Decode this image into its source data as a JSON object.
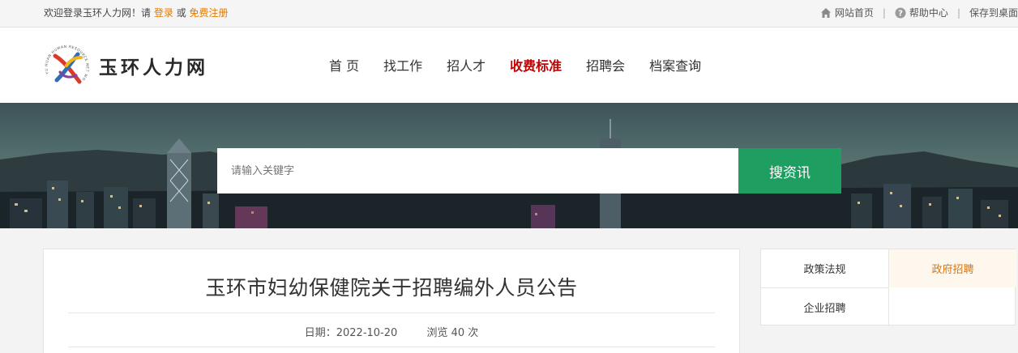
{
  "topbar": {
    "welcome_prefix": "欢迎登录玉环人力网！请",
    "login": "登录",
    "or": "或",
    "register": "免费注册",
    "links": [
      {
        "label": "网站首页",
        "icon": "home-icon"
      },
      {
        "label": "帮助中心",
        "icon": "help-icon"
      },
      {
        "label": "保存到桌面",
        "icon": ""
      }
    ],
    "separator": "|"
  },
  "header": {
    "logo_text": "玉环人力网",
    "logo_ring_text": "YU HUAN HUMAN RESOURCE NET WORK",
    "nav": [
      {
        "label": "首 页",
        "active": false
      },
      {
        "label": "找工作",
        "active": false
      },
      {
        "label": "招人才",
        "active": false
      },
      {
        "label": "收费标准",
        "active": true
      },
      {
        "label": "招聘会",
        "active": false
      },
      {
        "label": "档案查询",
        "active": false
      }
    ]
  },
  "search": {
    "placeholder": "请输入关键字",
    "button": "搜资讯"
  },
  "article": {
    "title": "玉环市妇幼保健院关于招聘编外人员公告",
    "date_label": "日期：2022-10-20",
    "views_label": "浏览 40 次"
  },
  "sidebar": {
    "tabs": [
      {
        "label": "政策法规",
        "active": false
      },
      {
        "label": "政府招聘",
        "active": true
      },
      {
        "label": "企业招聘",
        "active": false
      }
    ]
  },
  "colors": {
    "accent_green": "#1e9f61",
    "active_nav": "#c40000",
    "link_orange": "#e07a00",
    "active_tab": "#d9750b"
  }
}
